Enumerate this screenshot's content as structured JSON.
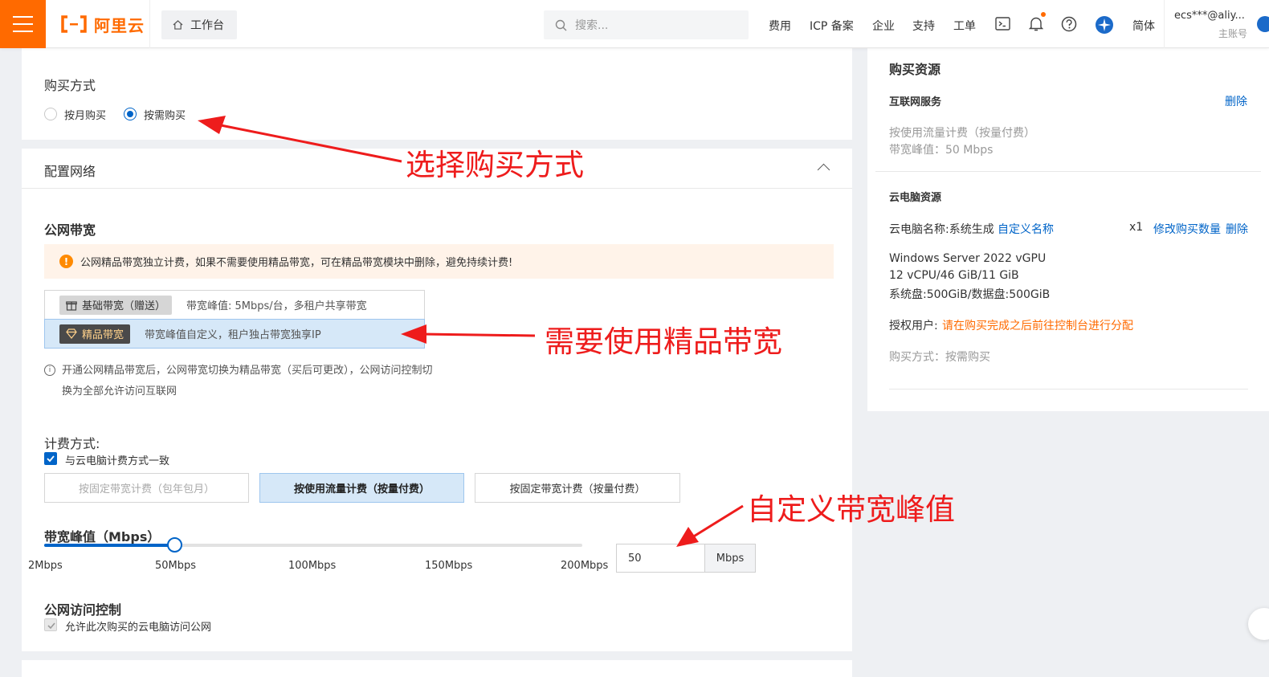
{
  "topbar": {
    "logo": "阿里云",
    "workbench": "工作台",
    "search_placeholder": "搜索...",
    "nav": [
      "费用",
      "ICP 备案",
      "企业",
      "支持",
      "工单"
    ],
    "lang": "简体",
    "account": "ecs***@aliy...",
    "account_role": "主账号"
  },
  "purchase": {
    "title": "购买方式",
    "options": [
      "按月购买",
      "按需购买"
    ],
    "selected": "按需购买"
  },
  "network": {
    "title": "配置网络",
    "public_bw_title": "公网带宽",
    "alert": "公网精品带宽独立计费，如果不需要使用精品带宽，可在精品带宽模块中删除，避免持续计费!",
    "basic_tag": "基础带宽（赠送）",
    "basic_desc": "带宽峰值: 5Mbps/台，多租户共享带宽",
    "premium_tag": "精品带宽",
    "premium_desc": "带宽峰值自定义，租户独占带宽独享IP",
    "info_line1": "开通公网精品带宽后，公网带宽切换为精品带宽（买后可更改），公网访问控制切",
    "info_line2": "换为全部允许访问互联网",
    "billing_title": "计费方式:",
    "billing_sync": "与云电脑计费方式一致",
    "billing_options": [
      "按固定带宽计费（包年包月）",
      "按使用流量计费（按量付费）",
      "按固定带宽计费（按量付费）"
    ],
    "peak_title": "带宽峰值（Mbps）",
    "ticks": [
      "2Mbps",
      "50Mbps",
      "100Mbps",
      "150Mbps",
      "200Mbps"
    ],
    "slider_min": 2,
    "slider_max": 200,
    "peak_value": "50",
    "peak_unit": "Mbps",
    "access_title": "公网访问控制",
    "access_allow": "允许此次购买的云电脑访问公网"
  },
  "summary": {
    "title": "购买资源",
    "internet_service": "互联网服务",
    "delete": "删除",
    "billing_line": "按使用流量计费（按量付费）",
    "peak_line": "带宽峰值：50 Mbps",
    "cloud_res": "云电脑资源",
    "name_label": "云电脑名称:系统生成",
    "custom_name": "自定义名称",
    "qty": "x1",
    "modify_qty": "修改购买数量",
    "delete2": "删除",
    "spec1": "Windows Server 2022 vGPU",
    "spec2": "12 vCPU/46 GiB/11 GiB",
    "spec3": "系统盘:500GiB/数据盘:500GiB",
    "auth_label": "授权用户:",
    "auth_value": "请在购买完成之后前往控制台进行分配",
    "buy_mode": "购买方式：按需购买"
  },
  "annotations": {
    "a1": "选择购买方式",
    "a2": "需要使用精品带宽",
    "a3": "自定义带宽峰值"
  },
  "colors": {
    "brand": "#ff6a00",
    "primary": "#0064c8",
    "annotation": "#ee1c1c"
  }
}
